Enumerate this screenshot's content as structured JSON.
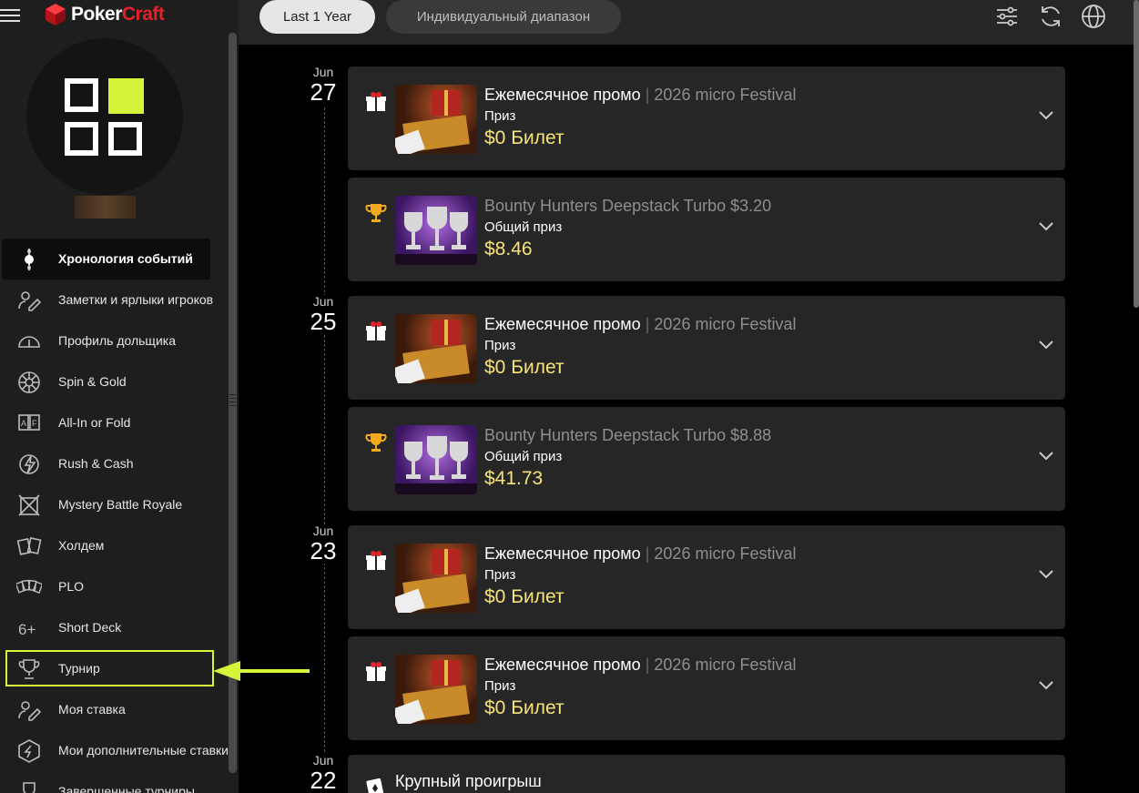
{
  "app": {
    "logo_prefix": "Poker",
    "logo_suffix": "Craft"
  },
  "header": {
    "filter_selected": "Last 1 Year",
    "filter_custom": "Индивидуальный диапазон",
    "icons": [
      "sliders-icon",
      "refresh-icon",
      "globe-icon"
    ]
  },
  "sidebar": {
    "items": [
      {
        "label": "Хронология событий",
        "icon": "timeline-icon",
        "active": true
      },
      {
        "label": "Заметки и ярлыки игроков",
        "icon": "notes-icon"
      },
      {
        "label": "Профиль дольщика",
        "icon": "gauge-icon"
      },
      {
        "label": "Spin & Gold",
        "icon": "spin-icon"
      },
      {
        "label": "All-In or Fold",
        "icon": "allin-fold-icon"
      },
      {
        "label": "Rush & Cash",
        "icon": "rush-icon"
      },
      {
        "label": "Mystery Battle Royale",
        "icon": "mystery-icon"
      },
      {
        "label": "Холдем",
        "icon": "cards-icon"
      },
      {
        "label": "PLO",
        "icon": "plo-icon"
      },
      {
        "label": "Short Deck",
        "icon": "short-deck-icon"
      },
      {
        "label": "Турнир",
        "icon": "trophy-icon",
        "highlighted": true
      },
      {
        "label": "Моя ставка",
        "icon": "stake-icon"
      },
      {
        "label": "Мои дополнительные ставки",
        "icon": "extra-stake-icon"
      },
      {
        "label": "Завершенные турниры",
        "icon": "finished-icon"
      }
    ]
  },
  "timeline": {
    "dates": [
      {
        "month": "Jun",
        "day": "27"
      },
      {
        "month": "Jun",
        "day": "25"
      },
      {
        "month": "Jun",
        "day": "23"
      },
      {
        "month": "Jun",
        "day": "22"
      }
    ],
    "events": [
      {
        "kind": "gift",
        "title": "Ежемесячное промо",
        "subtitle": "2026 micro Festival",
        "label": "Приз",
        "value": "$0 Билет"
      },
      {
        "kind": "trophy",
        "title": "Bounty Hunters Deepstack Turbo $3.20",
        "label": "Общий приз",
        "value": "$8.46"
      },
      {
        "kind": "gift",
        "title": "Ежемесячное промо",
        "subtitle": "2026 micro Festival",
        "label": "Приз",
        "value": "$0 Билет"
      },
      {
        "kind": "trophy",
        "title": "Bounty Hunters Deepstack Turbo $8.88",
        "label": "Общий приз",
        "value": "$41.73"
      },
      {
        "kind": "gift",
        "title": "Ежемесячное промо",
        "subtitle": "2026 micro Festival",
        "label": "Приз",
        "value": "$0 Билет"
      },
      {
        "kind": "gift",
        "title": "Ежемесячное промо",
        "subtitle": "2026 micro Festival",
        "label": "Приз",
        "value": "$0 Билет"
      },
      {
        "kind": "loss",
        "title": "Крупный проигрыш"
      }
    ]
  },
  "colors": {
    "accent": "#d4f53a",
    "prize": "#f7e37a",
    "brand_red": "#e3222a"
  }
}
